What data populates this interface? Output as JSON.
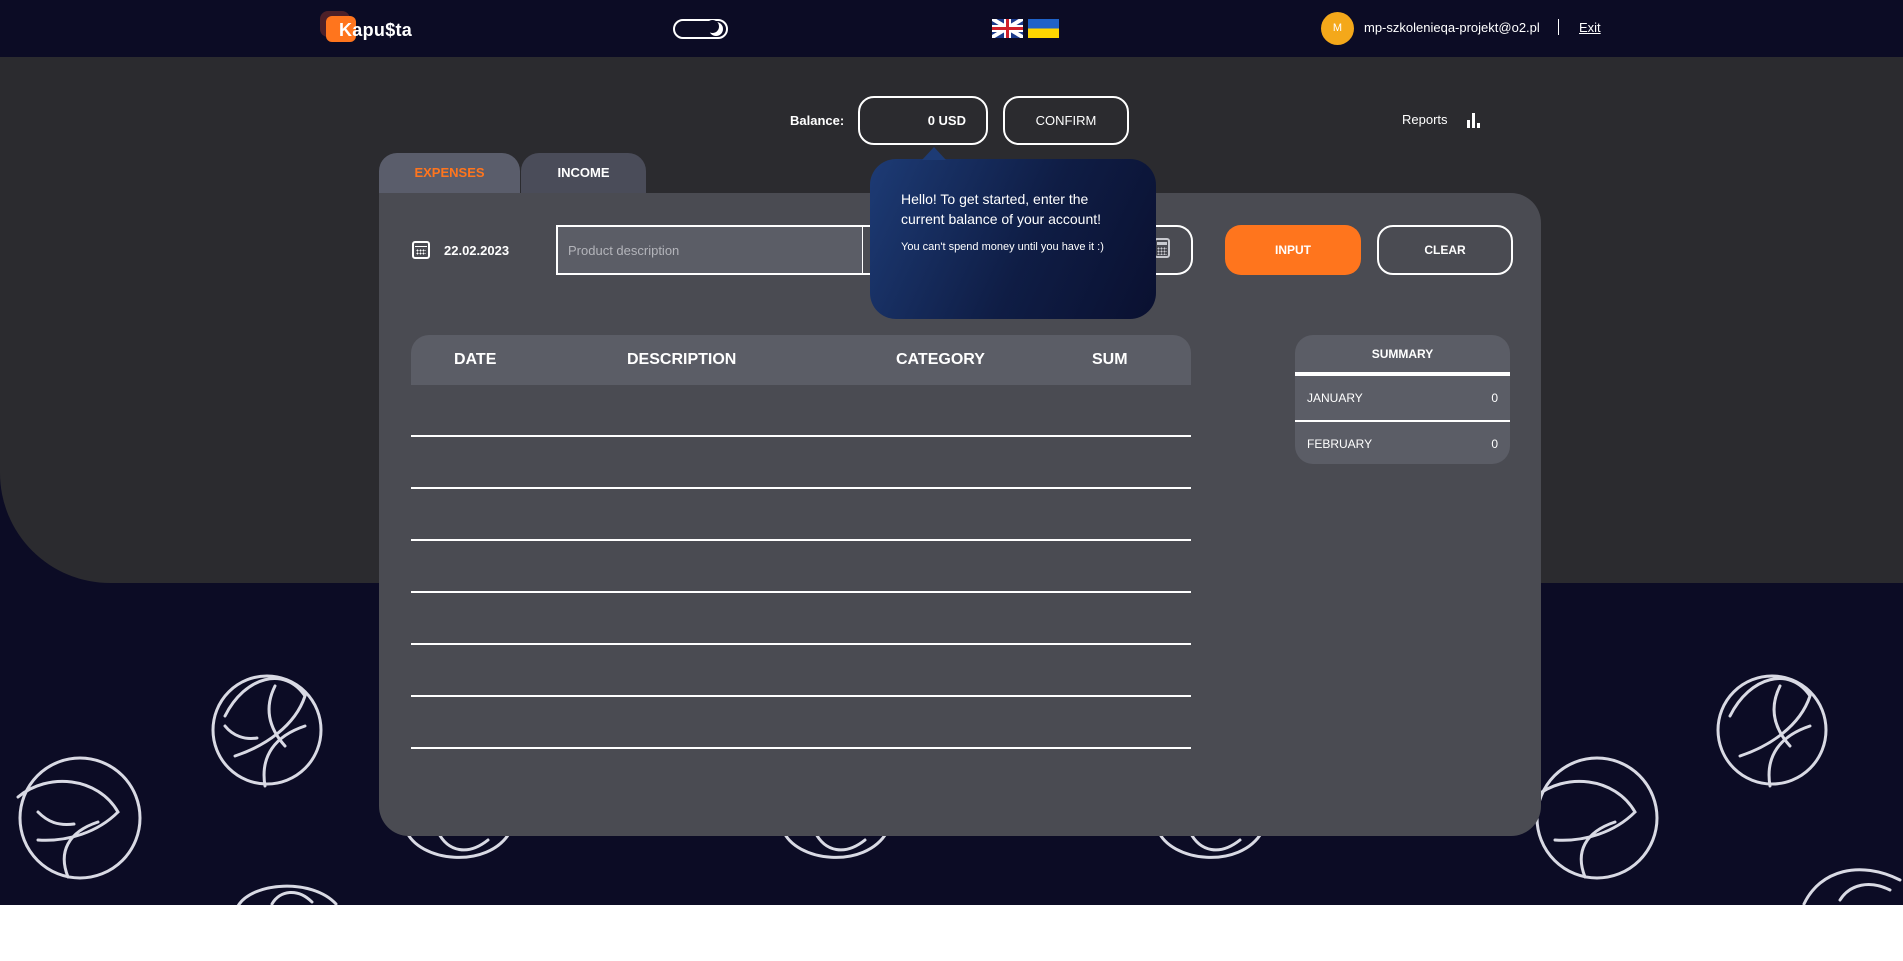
{
  "brand": {
    "logo_text": "Kapu$ta"
  },
  "header": {
    "user_initial": "M",
    "user_email": "mp-szkolenieqa-projekt@o2.pl",
    "exit_label": "Exit"
  },
  "balance": {
    "label": "Balance:",
    "value": "0 USD",
    "confirm_label": "CONFIRM"
  },
  "reports": {
    "label": "Reports"
  },
  "tabs": [
    {
      "label": "EXPENSES",
      "active": true
    },
    {
      "label": "INCOME",
      "active": false
    }
  ],
  "form": {
    "date": "22.02.2023",
    "description_placeholder": "Product description",
    "input_label": "INPUT",
    "clear_label": "CLEAR"
  },
  "tooltip": {
    "line1": "Hello! To get started, enter the current balance of your account!",
    "line2": "You can't spend money until you have it :)"
  },
  "table": {
    "headers": [
      "DATE",
      "DESCRIPTION",
      "CATEGORY",
      "SUM"
    ],
    "rows": []
  },
  "summary": {
    "title": "SUMMARY",
    "months": [
      {
        "month": "JANUARY",
        "value": "0"
      },
      {
        "month": "FEBRUARY",
        "value": "0"
      }
    ]
  },
  "colors": {
    "accent": "#ff751d",
    "header_bg": "#0c0c25",
    "upper_bg": "#2b2b2f",
    "panel_bg": "#4a4b52",
    "tooltip_bg": "#1d3b75"
  }
}
